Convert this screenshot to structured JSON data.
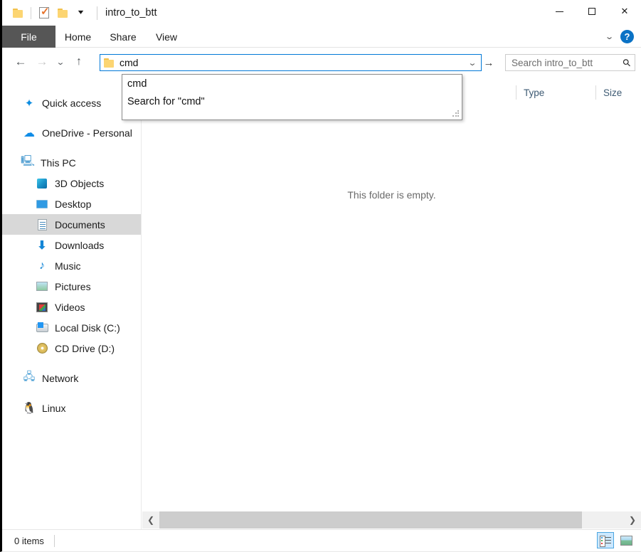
{
  "window": {
    "title": "intro_to_btt",
    "controls": {
      "minimize": "—",
      "maximize": "□",
      "close": "✕"
    }
  },
  "quick_access_toolbar": {
    "items": [
      {
        "name": "folder-icon",
        "label": ""
      },
      {
        "name": "properties-icon",
        "label": ""
      },
      {
        "name": "new-folder-icon",
        "label": ""
      },
      {
        "name": "customize-chevron",
        "label": "▾"
      }
    ]
  },
  "ribbon": {
    "tabs": [
      {
        "label": "File",
        "selected": true
      },
      {
        "label": "Home",
        "selected": false
      },
      {
        "label": "Share",
        "selected": false
      },
      {
        "label": "View",
        "selected": false
      }
    ],
    "expand_chevron": "⌄",
    "help_label": "?"
  },
  "navigation": {
    "back": "←",
    "forward": "→",
    "recent": "⌄",
    "up": "↑"
  },
  "address_bar": {
    "value": "cmd",
    "chevron": "⌄",
    "go": "→"
  },
  "search": {
    "placeholder": "Search intro_to_btt",
    "icon": "⚲"
  },
  "autocomplete": {
    "items": [
      {
        "label": "cmd"
      },
      {
        "label": "Search for \"cmd\""
      }
    ]
  },
  "sidebar": {
    "items": [
      {
        "label": "Quick access",
        "icon": "pin-star-icon",
        "level": 0,
        "selected": false
      },
      {
        "label": "OneDrive - Personal",
        "icon": "onedrive-cloud-icon",
        "level": 0,
        "selected": false
      },
      {
        "label": "This PC",
        "icon": "this-pc-icon",
        "level": 0,
        "selected": false
      },
      {
        "label": "3D Objects",
        "icon": "3d-objects-icon",
        "level": 2,
        "selected": false
      },
      {
        "label": "Desktop",
        "icon": "desktop-icon",
        "level": 2,
        "selected": false
      },
      {
        "label": "Documents",
        "icon": "documents-icon",
        "level": 2,
        "selected": true
      },
      {
        "label": "Downloads",
        "icon": "downloads-icon",
        "level": 2,
        "selected": false
      },
      {
        "label": "Music",
        "icon": "music-icon",
        "level": 2,
        "selected": false
      },
      {
        "label": "Pictures",
        "icon": "pictures-icon",
        "level": 2,
        "selected": false
      },
      {
        "label": "Videos",
        "icon": "videos-icon",
        "level": 2,
        "selected": false
      },
      {
        "label": "Local Disk (C:)",
        "icon": "local-disk-icon",
        "level": 2,
        "selected": false
      },
      {
        "label": "CD Drive (D:)",
        "icon": "cd-drive-icon",
        "level": 2,
        "selected": false
      },
      {
        "label": "Network",
        "icon": "network-icon",
        "level": 0,
        "selected": false
      },
      {
        "label": "Linux",
        "icon": "linux-penguin-icon",
        "level": 0,
        "selected": false
      }
    ]
  },
  "file_list": {
    "columns": [
      {
        "label": "Type",
        "width": 110
      },
      {
        "label": "Size",
        "width": 80
      }
    ],
    "empty_message": "This folder is empty.",
    "rows": []
  },
  "status_bar": {
    "item_count": "0 items",
    "views": [
      {
        "name": "details-view",
        "selected": true
      },
      {
        "name": "large-icons-view",
        "selected": false
      }
    ]
  },
  "colors": {
    "accent": "#0078d7",
    "file_tab_bg": "#565656",
    "selection": "#d8d8d8",
    "help_blue": "#0a72c5"
  }
}
